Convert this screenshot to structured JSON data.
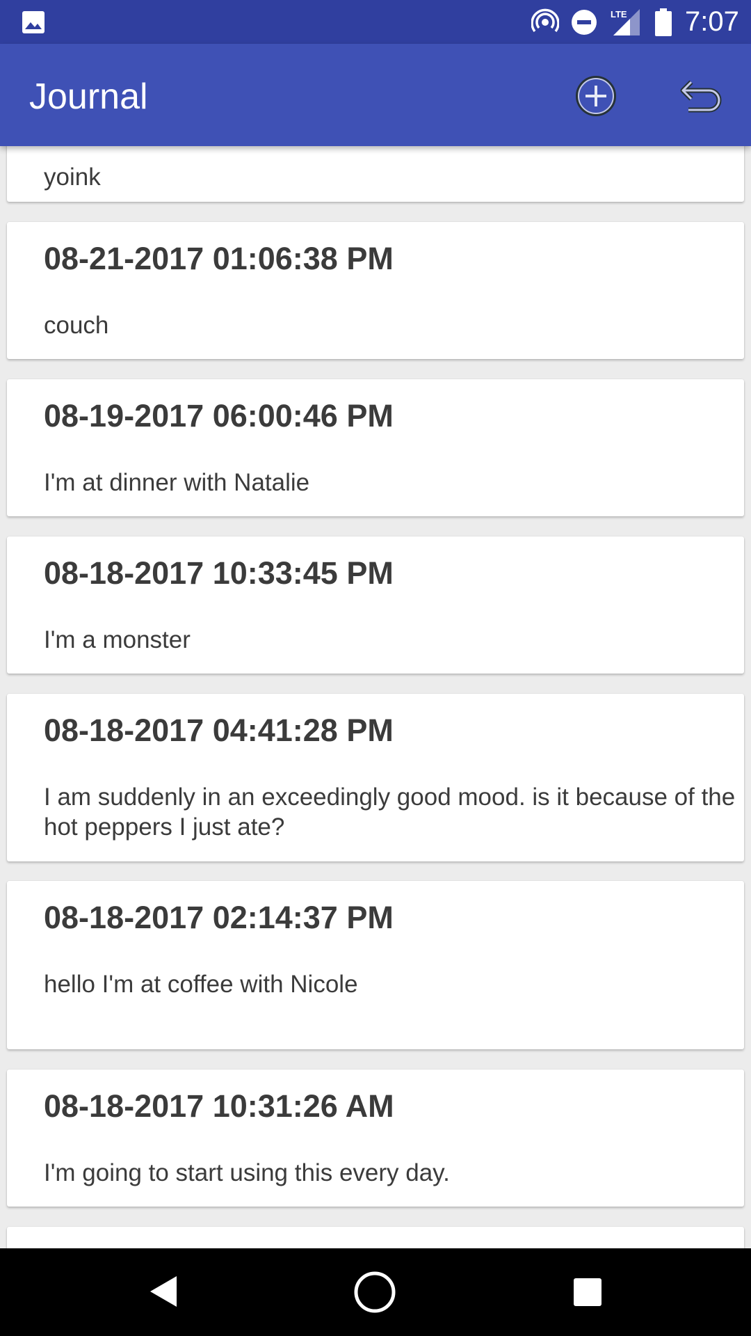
{
  "status_bar": {
    "time": "7:07",
    "network": "LTE",
    "icons": [
      "gallery-icon",
      "hotspot-icon",
      "do-not-disturb-icon",
      "signal-icon",
      "battery-icon"
    ]
  },
  "app_bar": {
    "title": "Journal",
    "actions": [
      "add-entry-icon",
      "undo-back-icon"
    ],
    "color": "#3f51b5",
    "status_color": "#303f9f"
  },
  "entries": [
    {
      "date": "",
      "text": "yoink"
    },
    {
      "date": "08-21-2017 01:06:38 PM",
      "text": "couch"
    },
    {
      "date": "08-19-2017 06:00:46 PM",
      "text": "I'm at dinner with Natalie"
    },
    {
      "date": "08-18-2017 10:33:45 PM",
      "text": "I'm a monster"
    },
    {
      "date": "08-18-2017 04:41:28 PM",
      "text": "I am suddenly in an exceedingly good mood. is it because of the hot peppers I just ate?"
    },
    {
      "date": "08-18-2017 02:14:37 PM",
      "text": "hello I'm at coffee with Nicole"
    },
    {
      "date": "08-18-2017 10:31:26 AM",
      "text": "I'm going to start using this every day."
    }
  ],
  "nav_bar": {
    "buttons": [
      "back-triangle-icon",
      "home-circle-icon",
      "recents-square-icon"
    ]
  }
}
